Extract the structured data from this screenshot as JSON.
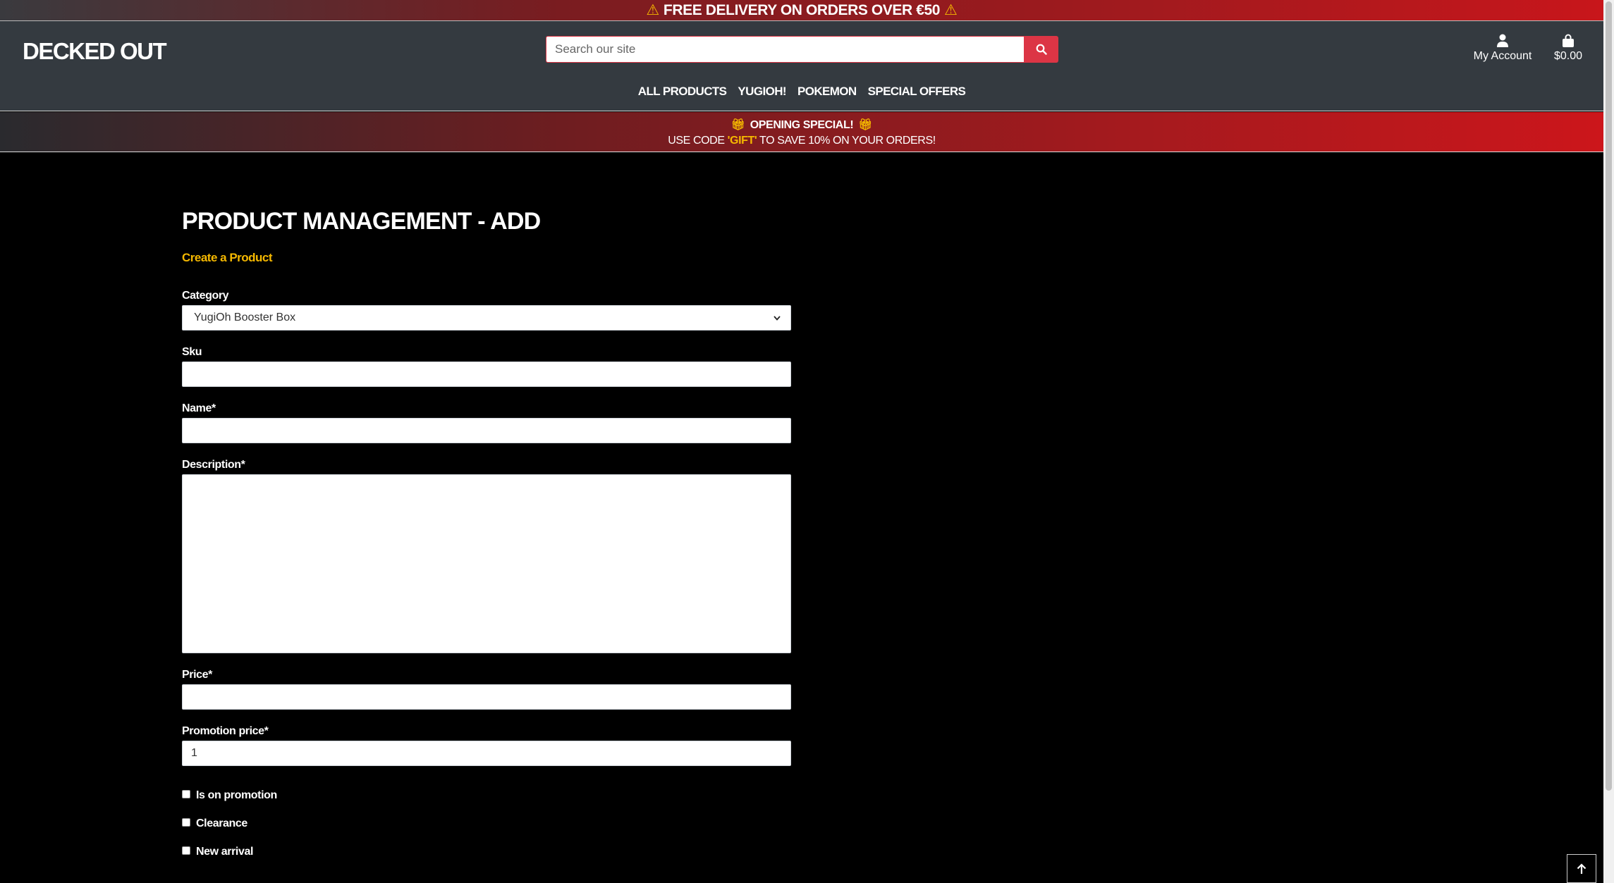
{
  "delivery_banner": {
    "text": "FREE DELIVERY ON ORDERS OVER €50"
  },
  "header": {
    "logo": "DECKED OUT",
    "search": {
      "placeholder": "Search our site",
      "value": ""
    },
    "account_label": "My Account",
    "bag_total": "$0.00"
  },
  "nav": {
    "items": [
      {
        "label": "ALL PRODUCTS"
      },
      {
        "label": "YUGIOH!"
      },
      {
        "label": "POKEMON"
      },
      {
        "label": "SPECIAL OFFERS"
      }
    ]
  },
  "promo": {
    "title": "OPENING SPECIAL!",
    "text_before": "USE CODE ",
    "code": "'GIFT'",
    "text_after": " TO SAVE 10% ON YOUR ORDERS!"
  },
  "main": {
    "title": "PRODUCT MANAGEMENT - ADD",
    "subtitle": "Create a Product",
    "form": {
      "category_label": "Category",
      "category_value": "YugiOh Booster Box",
      "sku_label": "Sku",
      "sku_value": "",
      "name_label": "Name*",
      "name_value": "",
      "description_label": "Description*",
      "description_value": "",
      "price_label": "Price*",
      "price_value": "",
      "promotion_price_label": "Promotion price*",
      "promotion_price_value": "1",
      "checkboxes": [
        {
          "label": "Is on promotion",
          "checked": false
        },
        {
          "label": "Clearance",
          "checked": false
        },
        {
          "label": "New arrival",
          "checked": false
        }
      ]
    }
  },
  "colors": {
    "accent_red": "#dc3545",
    "accent_yellow": "#f5b800",
    "header_bg": "#343a40",
    "page_bg": "#000000"
  }
}
